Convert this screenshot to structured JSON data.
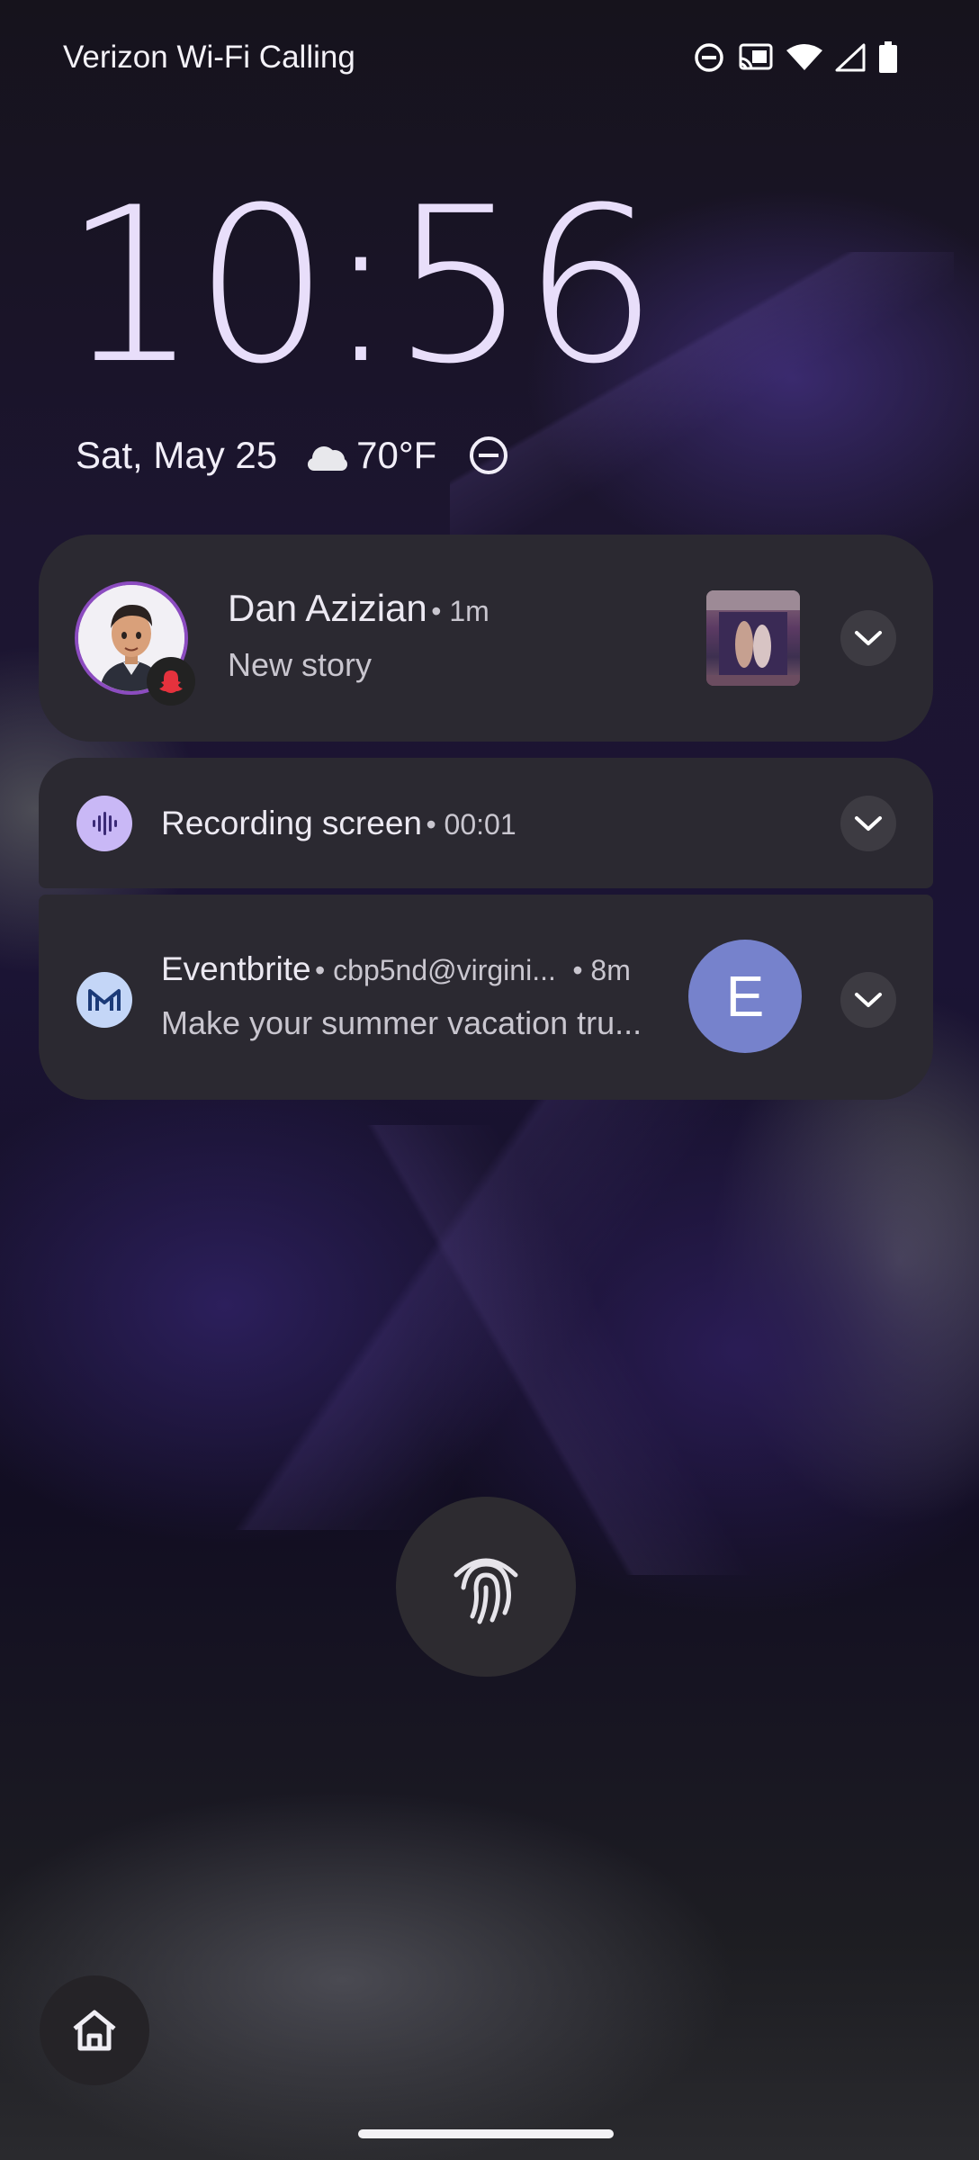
{
  "status_bar": {
    "carrier": "Verizon Wi-Fi Calling",
    "icons": [
      "do-not-disturb-icon",
      "cast-icon",
      "wifi-icon",
      "cellular-signal-icon",
      "battery-icon"
    ]
  },
  "lock_screen": {
    "time": "10:56",
    "date": "Sat, May 25",
    "weather_icon": "cloudy-icon",
    "temperature": "70°F",
    "status_icon": "do-not-disturb-icon"
  },
  "notifications": [
    {
      "app_icon": "snapchat-icon",
      "sender": "Dan Azizian",
      "time": "• 1m",
      "text": "New story",
      "has_thumbnail": true
    },
    {
      "app_icon": "screen-recorder-icon",
      "title": "Recording screen",
      "time": "• 00:01"
    },
    {
      "app_icon": "gmail-icon",
      "sender": "Eventbrite",
      "account": "• cbp5nd@virgini...",
      "time": "• 8m",
      "text": "Make your summer vacation tru...",
      "avatar_letter": "E",
      "avatar_color": "#7682cc"
    }
  ],
  "bottom": {
    "fingerprint_icon": "fingerprint-icon",
    "shortcut_icon": "home-icon"
  },
  "colors": {
    "card_bg": "#2b2931",
    "clock": "#e8defa",
    "accent": "#c9b8f6"
  }
}
